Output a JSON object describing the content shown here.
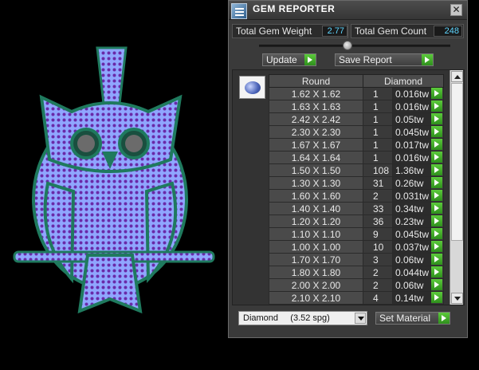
{
  "panel": {
    "title": "GEM REPORTER",
    "close_glyph": "✕",
    "icons": {
      "app": "report-list-icon",
      "close": "close-icon",
      "gem": "round-gem-icon"
    }
  },
  "stats": {
    "weight_label": "Total Gem Weight",
    "weight_value": "2.77",
    "count_label": "Total Gem Count",
    "count_value": "248"
  },
  "controls": {
    "update_label": "Update",
    "save_label": "Save Report",
    "set_material_label": "Set Material"
  },
  "table": {
    "shape_header": "Round",
    "material_header": "Diamond",
    "rows": [
      {
        "size": "1.62 X 1.62",
        "count": "1",
        "cwt": "0.016tw"
      },
      {
        "size": "1.63 X 1.63",
        "count": "1",
        "cwt": "0.016tw"
      },
      {
        "size": "2.42 X 2.42",
        "count": "1",
        "cwt": "0.05tw"
      },
      {
        "size": "2.30 X 2.30",
        "count": "1",
        "cwt": "0.045tw"
      },
      {
        "size": "1.67 X 1.67",
        "count": "1",
        "cwt": "0.017tw"
      },
      {
        "size": "1.64 X 1.64",
        "count": "1",
        "cwt": "0.016tw"
      },
      {
        "size": "1.50 X 1.50",
        "count": "108",
        "cwt": "1.36tw"
      },
      {
        "size": "1.30 X 1.30",
        "count": "31",
        "cwt": "0.26tw"
      },
      {
        "size": "1.60 X 1.60",
        "count": "2",
        "cwt": "0.031tw"
      },
      {
        "size": "1.40 X 1.40",
        "count": "33",
        "cwt": "0.34tw"
      },
      {
        "size": "1.20 X 1.20",
        "count": "36",
        "cwt": "0.23tw"
      },
      {
        "size": "1.10 X 1.10",
        "count": "9",
        "cwt": "0.045tw"
      },
      {
        "size": "1.00 X 1.00",
        "count": "10",
        "cwt": "0.037tw"
      },
      {
        "size": "1.70 X 1.70",
        "count": "3",
        "cwt": "0.06tw"
      },
      {
        "size": "1.80 X 1.80",
        "count": "2",
        "cwt": "0.044tw"
      },
      {
        "size": "2.00 X 2.00",
        "count": "2",
        "cwt": "0.06tw"
      },
      {
        "size": "2.10 X 2.10",
        "count": "4",
        "cwt": "0.14tw"
      }
    ]
  },
  "material": {
    "selected": "Diamond     (3.52 spg)"
  },
  "colors": {
    "metal": "#1f7a5e",
    "gem_fill": "#8fa6ff",
    "gem_dot": "#6a2aa8",
    "value_text": "#5fd6ff",
    "go_green": "#3fae26"
  }
}
